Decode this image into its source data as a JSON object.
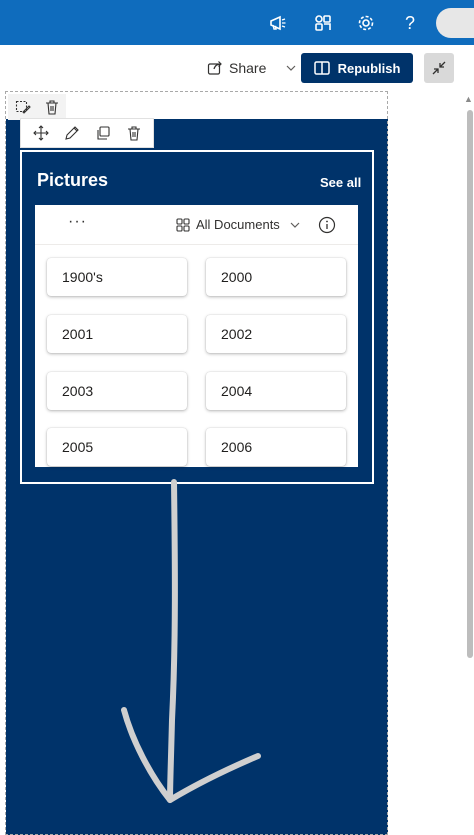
{
  "topbar": {
    "icons": [
      "megaphone-icon",
      "app-launcher-icon",
      "gear-icon",
      "help-icon"
    ],
    "help_glyph": "?",
    "accent_color": "#0f6cbd"
  },
  "commandbar": {
    "share_label": "Share",
    "republish_label": "Republish",
    "brand_color": "#00336a"
  },
  "webpart": {
    "title": "Pictures",
    "see_all": "See all",
    "more_label": "···",
    "view_label": "All Documents",
    "folders": [
      {
        "label": "1900's"
      },
      {
        "label": "2000"
      },
      {
        "label": "2001"
      },
      {
        "label": "2002"
      },
      {
        "label": "2003"
      },
      {
        "label": "2004"
      },
      {
        "label": "2005"
      },
      {
        "label": "2006"
      }
    ]
  }
}
